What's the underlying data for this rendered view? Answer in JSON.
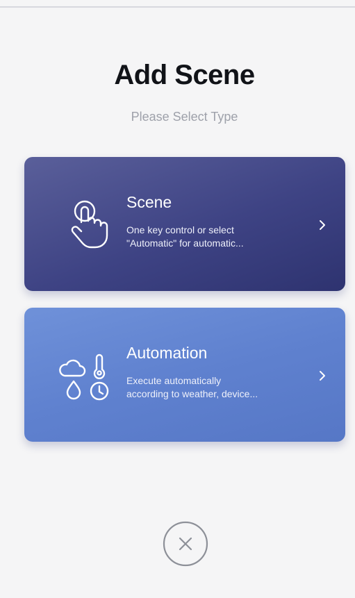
{
  "header": {
    "title": "Add Scene",
    "subtitle": "Please Select Type"
  },
  "cards": [
    {
      "title": "Scene",
      "desc_line1": "One key control or select",
      "desc_line2": "\"Automatic\" for automatic...",
      "icon": "tap-hand-icon",
      "color": "#3e4384"
    },
    {
      "title": "Automation",
      "desc_line1": "Execute automatically",
      "desc_line2": "according to weather, device...",
      "icon": "weather-conditions-icon",
      "color": "#5f81cf"
    }
  ],
  "close": {
    "icon": "close-icon"
  }
}
